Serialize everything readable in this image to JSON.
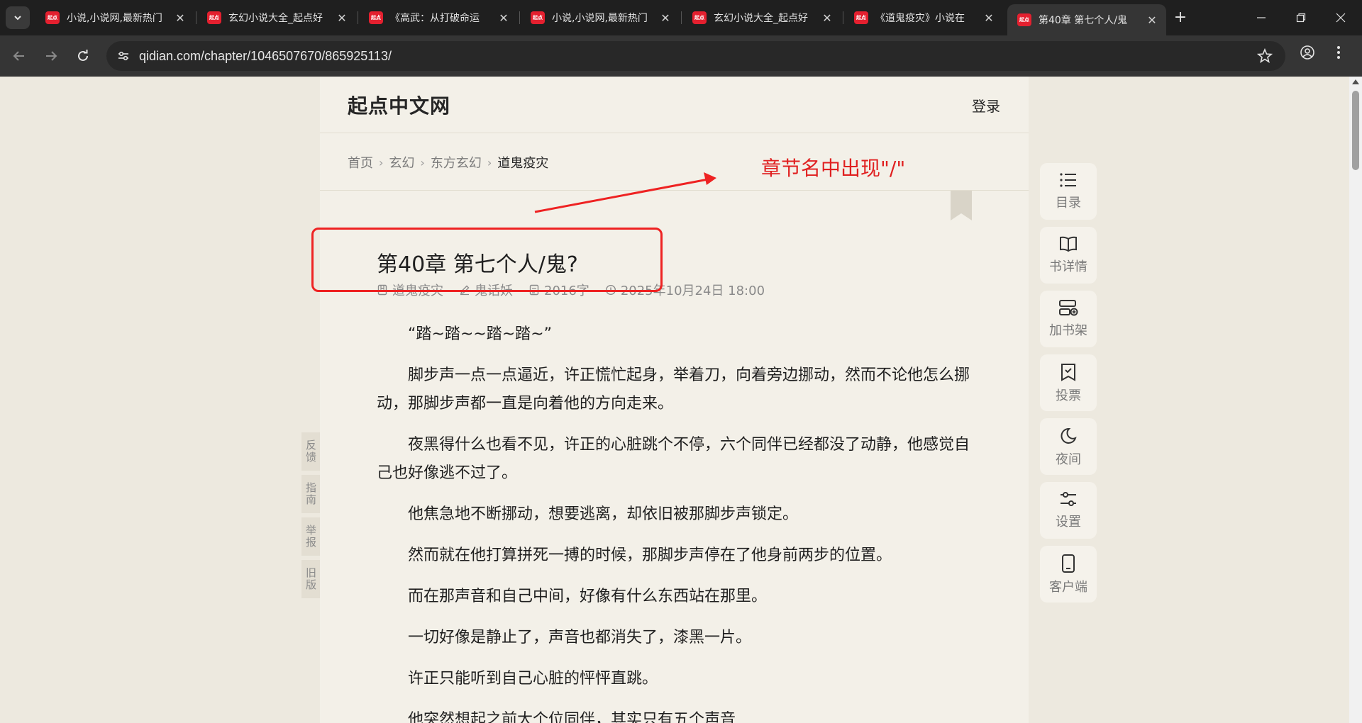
{
  "browser": {
    "tabs": [
      {
        "favicon": "起点",
        "title": "小说,小说网,最新热门"
      },
      {
        "favicon": "起点",
        "title": "玄幻小说大全_起点好"
      },
      {
        "favicon": "起点",
        "title": "《高武：从打破命运"
      },
      {
        "favicon": "起点",
        "title": "小说,小说网,最新热门"
      },
      {
        "favicon": "起点",
        "title": "玄幻小说大全_起点好"
      },
      {
        "favicon": "起点",
        "title": "《道鬼疫灾》小说在"
      },
      {
        "favicon": "起点",
        "title": "第40章 第七个人/鬼"
      }
    ],
    "active_tab_index": 6,
    "url": "qidian.com/chapter/1046507670/865925113/"
  },
  "site": {
    "logo": "起点中文网",
    "login": "登录"
  },
  "breadcrumb": {
    "items": [
      "首页",
      "玄幻",
      "东方玄幻"
    ],
    "current": "道鬼疫灾"
  },
  "chapter": {
    "title": "第40章 第七个人/鬼?",
    "book": "道鬼疫灾",
    "author": "鬼话妖",
    "word_count": "2016字",
    "date": "2025年10月24日 18:00"
  },
  "content": {
    "paragraphs": [
      "“踏~踏~~踏~踏~”",
      "脚步声一点一点逼近，许正慌忙起身，举着刀，向着旁边挪动，然而不论他怎么挪动，那脚步声都一直是向着他的方向走来。",
      "夜黑得什么也看不见，许正的心脏跳个不停，六个同伴已经都没了动静，他感觉自己也好像逃不过了。",
      "他焦急地不断挪动，想要逃离，却依旧被那脚步声锁定。",
      "然而就在他打算拼死一搏的时候，那脚步声停在了他身前两步的位置。",
      "而在那声音和自己中间，好像有什么东西站在那里。",
      "一切好像是静止了，声音也都消失了，漆黑一片。",
      "许正只能听到自己心脏的怦怦直跳。",
      "他突然想起之前大个位同伴，其实只有五个声音"
    ]
  },
  "side_tabs": [
    "反馈",
    "指南",
    "举报",
    "旧版"
  ],
  "right_toolbar": [
    {
      "icon": "list-icon",
      "label": "目录"
    },
    {
      "icon": "book-open-icon",
      "label": "书详情"
    },
    {
      "icon": "shelf-add-icon",
      "label": "加书架"
    },
    {
      "icon": "vote-icon",
      "label": "投票"
    },
    {
      "icon": "moon-icon",
      "label": "夜间"
    },
    {
      "icon": "sliders-icon",
      "label": "设置"
    },
    {
      "icon": "phone-icon",
      "label": "客户端"
    }
  ],
  "annotation": {
    "text": "章节名中出现\"/\"",
    "color": "#e02020"
  }
}
